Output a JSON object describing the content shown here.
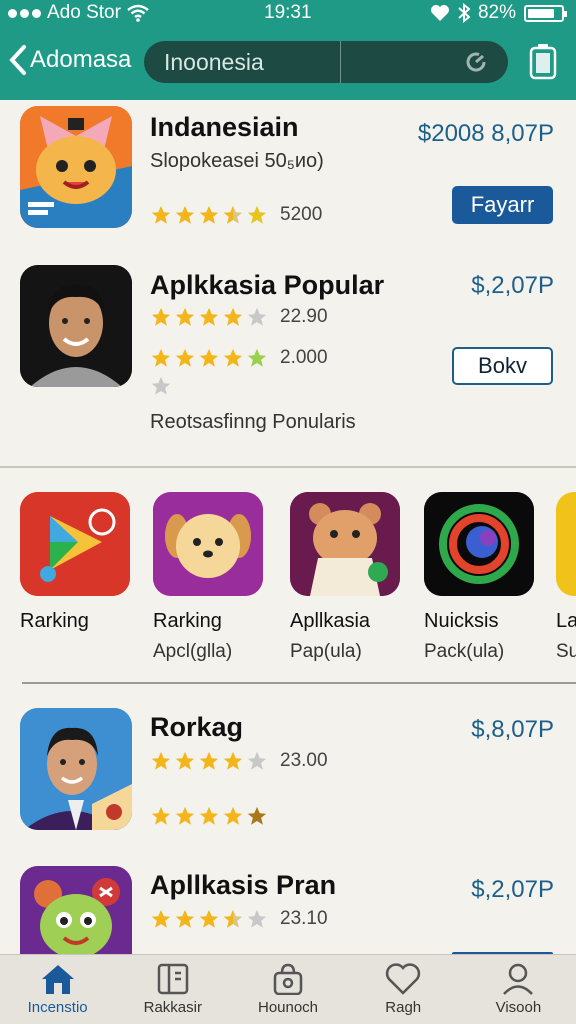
{
  "status": {
    "carrier": "Ado Stor",
    "time": "19:31",
    "battery": "82%"
  },
  "nav": {
    "back_label": "Adomasa",
    "search_placeholder": "Inoonesia"
  },
  "featured": [
    {
      "name": "Indanesiain",
      "subtitle": "Slopokeasei 50₅ᴎo)",
      "price": "$2008 8,07P",
      "rating_text": "5200",
      "stars": 4.5,
      "button": "Fayarr"
    },
    {
      "name": "Aplkkasia Popular",
      "price": "$,2,07P",
      "rating_text": "22.90",
      "stars": 4,
      "rating_text_2": "2.000",
      "stars_2": 4.5,
      "button": "Bokv"
    }
  ],
  "section_label": "Reotsasfinng Ponularis",
  "carousel": [
    {
      "title": "Rarking",
      "subtitle": "",
      "icon": "play-store-icon"
    },
    {
      "title": "Rarking",
      "subtitle": "Apcl(glla)",
      "icon": "dog-icon"
    },
    {
      "title": "Apllkasia",
      "subtitle": "Pap(ula)",
      "icon": "hamster-icon"
    },
    {
      "title": "Nuicksis",
      "subtitle": "Pack(ula)",
      "icon": "swirl-icon"
    },
    {
      "title": "La",
      "subtitle": "Su",
      "icon": "partial-icon"
    }
  ],
  "list": [
    {
      "name": "Rorkag",
      "price": "$,8,07P",
      "rating_text": "23.00",
      "stars": 4,
      "stars_2": 5
    },
    {
      "name": "Apllkasis Pran",
      "price": "$,2,07P",
      "rating_text": "23.10",
      "stars": 3.5
    }
  ],
  "tabs": [
    {
      "label": "Incenstio",
      "icon": "home-icon"
    },
    {
      "label": "Rakkasir",
      "icon": "book-icon"
    },
    {
      "label": "Hounoch",
      "icon": "bag-icon"
    },
    {
      "label": "Ragh",
      "icon": "heart-icon"
    },
    {
      "label": "Visooh",
      "icon": "person-icon"
    }
  ],
  "colors": {
    "header": "#1f9a86",
    "accent": "#1a5a9a",
    "star": "#f2b51a"
  }
}
